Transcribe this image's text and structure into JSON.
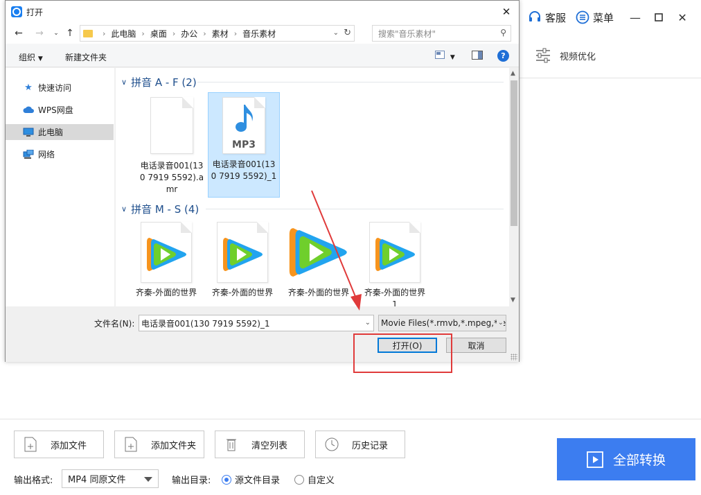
{
  "app": {
    "service_label": "客服",
    "menu_label": "菜单",
    "video_optimize_label": "视频优化",
    "toolbar": {
      "add_file": "添加文件",
      "add_folder": "添加文件夹",
      "clear_list": "清空列表",
      "history": "历史记录"
    },
    "convert_all": "全部转换",
    "output_format_label": "输出格式:",
    "output_format_value": "MP4 同原文件",
    "output_dir_label": "输出目录:",
    "output_dir_options": [
      "源文件目录",
      "自定义"
    ],
    "output_dir_selected": "源文件目录",
    "accent_color": "#3c7df0"
  },
  "dialog": {
    "title": "打开",
    "breadcrumb": [
      "此电脑",
      "桌面",
      "办公",
      "素材",
      "音乐素材"
    ],
    "search_placeholder": "搜索\"音乐素材\"",
    "organize_label": "组织",
    "new_folder_label": "新建文件夹",
    "help_label": "?",
    "nav_items": [
      {
        "label": "快速访问",
        "icon": "star-icon"
      },
      {
        "label": "WPS网盘",
        "icon": "cloud-icon"
      },
      {
        "label": "此电脑",
        "icon": "computer-icon",
        "selected": true
      },
      {
        "label": "网络",
        "icon": "network-icon"
      }
    ],
    "groups": [
      {
        "header": "拼音 A - F (2)",
        "files": [
          {
            "name": "电话录音001(130 7919 5592).amr",
            "icon": "blank-document-icon"
          },
          {
            "name": "电话录音001(130 7919 5592)_1",
            "icon": "mp3-file-icon",
            "badge": "MP3",
            "selected": true
          }
        ]
      },
      {
        "header": "拼音 M - S (4)",
        "files": [
          {
            "name": "齐秦-外面的世界",
            "icon": "tencent-video-file-icon"
          },
          {
            "name": "齐秦-外面的世界",
            "icon": "tencent-video-file-icon"
          },
          {
            "name": "齐秦-外面的世界",
            "icon": "tencent-video-icon"
          },
          {
            "name": "齐秦-外面的世界 1",
            "icon": "tencent-video-file-icon"
          }
        ]
      }
    ],
    "filename_label": "文件名(N):",
    "filename_value": "电话录音001(130 7919 5592)_1",
    "filetype_value": "Movie Files(*.rmvb,*.mpeg,*.et",
    "open_button": "打开(O)",
    "cancel_button": "取消"
  },
  "annotation_color": "#e03a3a"
}
